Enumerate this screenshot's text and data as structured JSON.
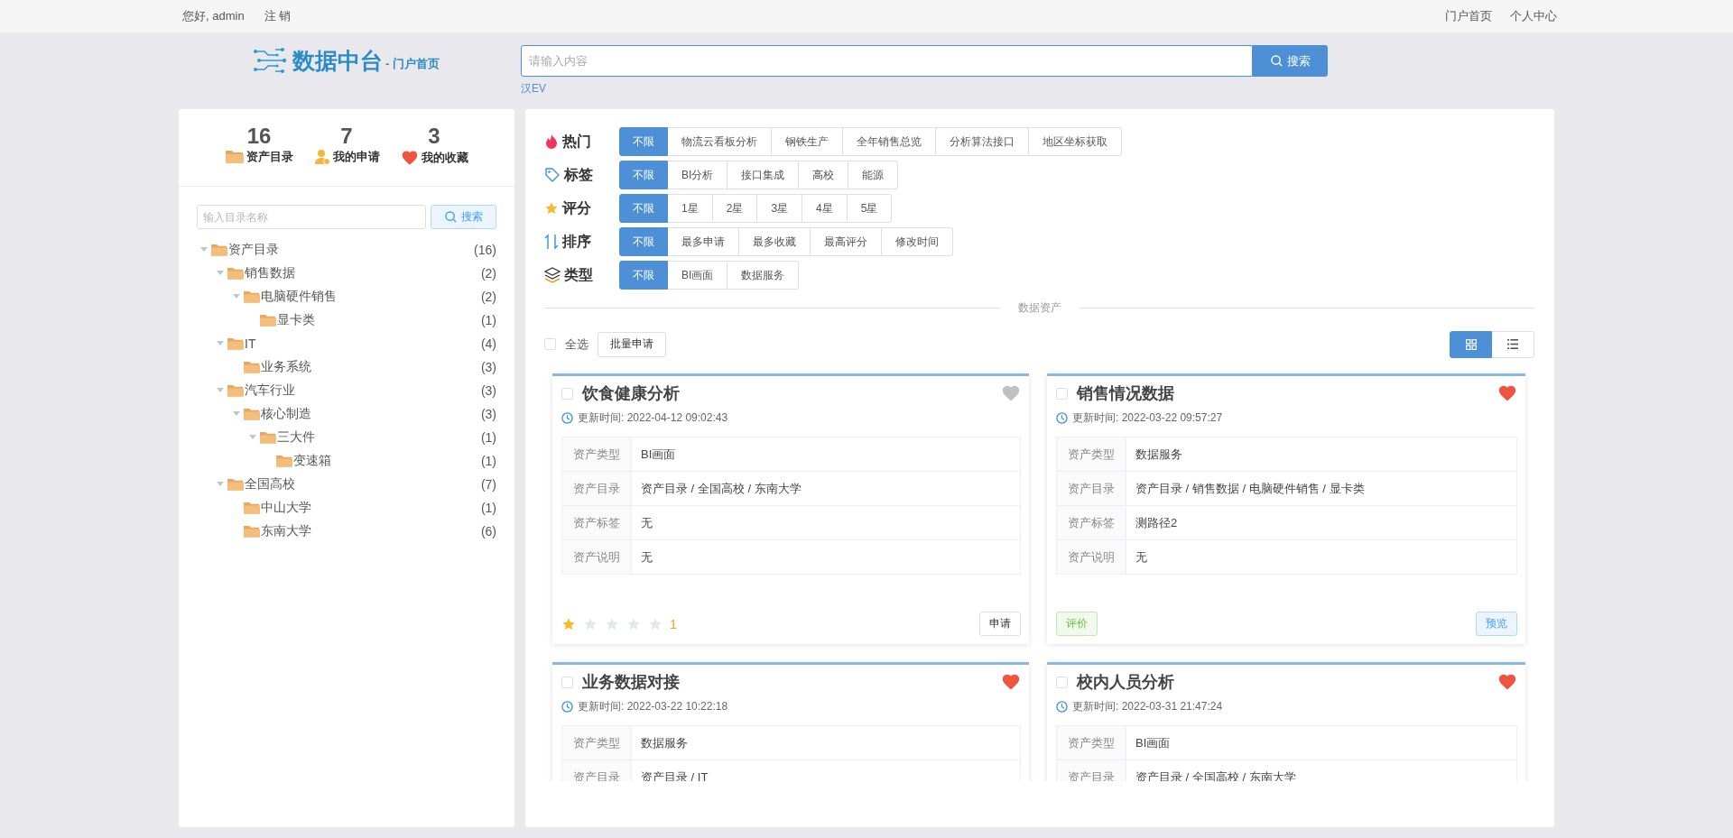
{
  "top_bar": {
    "greeting": "您好, admin",
    "logout": "注 销",
    "links": [
      "门户首页",
      "个人中心"
    ]
  },
  "header": {
    "logo_title": "数据中台",
    "logo_subtitle": "- 门户首页",
    "search": {
      "placeholder": "请输入内容",
      "button": "搜索"
    },
    "hot_link": "汉EV"
  },
  "stats": [
    {
      "kind": "folder",
      "count": "16",
      "label": "资产目录"
    },
    {
      "kind": "user",
      "count": "7",
      "label": "我的申请"
    },
    {
      "kind": "heart",
      "count": "3",
      "label": "我的收藏"
    }
  ],
  "catalog": {
    "search": {
      "placeholder": "输入目录名称",
      "button": "搜索"
    },
    "tree": [
      {
        "label": "资产目录",
        "count": "(16)",
        "expanded": true,
        "children": [
          {
            "label": "销售数据",
            "count": "(2)",
            "expanded": true,
            "children": [
              {
                "label": "电脑硬件销售",
                "count": "(2)",
                "expanded": true,
                "children": [
                  {
                    "label": "显卡类",
                    "count": "(1)"
                  }
                ]
              }
            ]
          },
          {
            "label": "IT",
            "count": "(4)",
            "expanded": true,
            "children": [
              {
                "label": "业务系统",
                "count": "(3)"
              }
            ]
          },
          {
            "label": "汽车行业",
            "count": "(3)",
            "expanded": true,
            "children": [
              {
                "label": "核心制造",
                "count": "(3)",
                "expanded": true,
                "children": [
                  {
                    "label": "三大件",
                    "count": "(1)",
                    "expanded": true,
                    "children": [
                      {
                        "label": "变速箱",
                        "count": "(1)"
                      }
                    ]
                  }
                ]
              }
            ]
          },
          {
            "label": "全国高校",
            "count": "(7)",
            "expanded": true,
            "children": [
              {
                "label": "中山大学",
                "count": "(1)"
              },
              {
                "label": "东南大学",
                "count": "(6)"
              }
            ]
          }
        ]
      }
    ]
  },
  "filters": [
    {
      "kind": "hot",
      "label": "热门",
      "options": [
        {
          "label": "不限",
          "selected": true
        },
        {
          "label": "物流云看板分析",
          "selected": false
        },
        {
          "label": "钢铁生产",
          "selected": false
        },
        {
          "label": "全年销售总览",
          "selected": false
        },
        {
          "label": "分析算法接口",
          "selected": false
        },
        {
          "label": "地区坐标获取",
          "selected": false
        }
      ]
    },
    {
      "kind": "tag",
      "label": "标签",
      "options": [
        {
          "label": "不限",
          "selected": true
        },
        {
          "label": "BI分析",
          "selected": false
        },
        {
          "label": "接口集成",
          "selected": false
        },
        {
          "label": "高校",
          "selected": false
        },
        {
          "label": "能源",
          "selected": false
        }
      ]
    },
    {
      "kind": "star",
      "label": "评分",
      "options": [
        {
          "label": "不限",
          "selected": true
        },
        {
          "label": "1星",
          "selected": false
        },
        {
          "label": "2星",
          "selected": false
        },
        {
          "label": "3星",
          "selected": false
        },
        {
          "label": "4星",
          "selected": false
        },
        {
          "label": "5星",
          "selected": false
        }
      ]
    },
    {
      "kind": "sort",
      "label": "排序",
      "options": [
        {
          "label": "不限",
          "selected": true
        },
        {
          "label": "最多申请",
          "selected": false
        },
        {
          "label": "最多收藏",
          "selected": false
        },
        {
          "label": "最高评分",
          "selected": false
        },
        {
          "label": "修改时间",
          "selected": false
        }
      ]
    },
    {
      "kind": "layers",
      "label": "类型",
      "options": [
        {
          "label": "不限",
          "selected": true
        },
        {
          "label": "BI画面",
          "selected": false
        },
        {
          "label": "数据服务",
          "selected": false
        }
      ]
    }
  ],
  "section_title": "数据资产",
  "toolbar": {
    "select_all": {
      "label": "全选",
      "checked": false
    },
    "batch_button": "批量申请",
    "views": [
      {
        "kind": "grid",
        "selected": true
      },
      {
        "kind": "list",
        "selected": false
      }
    ]
  },
  "assets": [
    {
      "title": "饮食健康分析",
      "checked": false,
      "favorite": false,
      "updated": "更新时间: 2022-04-12 09:02:43",
      "fields": [
        {
          "label": "资产类型",
          "value": "BI画面"
        },
        {
          "label": "资产目录",
          "value": "资产目录 / 全国高校 / 东南大学"
        },
        {
          "label": "资产标签",
          "value": "无"
        },
        {
          "label": "资产说明",
          "value": "无"
        }
      ],
      "stars": 1,
      "rating": "1",
      "actions": [
        {
          "kind": "apply",
          "label": "申请"
        }
      ]
    },
    {
      "title": "销售情况数据",
      "checked": false,
      "favorite": true,
      "updated": "更新时间: 2022-03-22 09:57:27",
      "fields": [
        {
          "label": "资产类型",
          "value": "数据服务"
        },
        {
          "label": "资产目录",
          "value": "资产目录 / 销售数据 / 电脑硬件销售 / 显卡类"
        },
        {
          "label": "资产标签",
          "value": "测路径2"
        },
        {
          "label": "资产说明",
          "value": "无"
        }
      ],
      "actions": [
        {
          "kind": "rate",
          "label": "评价"
        },
        {
          "kind": "preview",
          "label": "预览"
        }
      ]
    },
    {
      "title": "业务数据对接",
      "checked": false,
      "favorite": true,
      "updated": "更新时间: 2022-03-22 10:22:18",
      "fields": [
        {
          "label": "资产类型",
          "value": "数据服务"
        },
        {
          "label": "资产目录",
          "value": "资产目录 / IT"
        }
      ]
    },
    {
      "title": "校内人员分析",
      "checked": false,
      "favorite": true,
      "updated": "更新时间: 2022-03-31 21:47:24",
      "fields": [
        {
          "label": "资产类型",
          "value": "BI画面"
        },
        {
          "label": "资产目录",
          "value": "资产目录 / 全国高校 / 东南大学"
        }
      ]
    }
  ]
}
